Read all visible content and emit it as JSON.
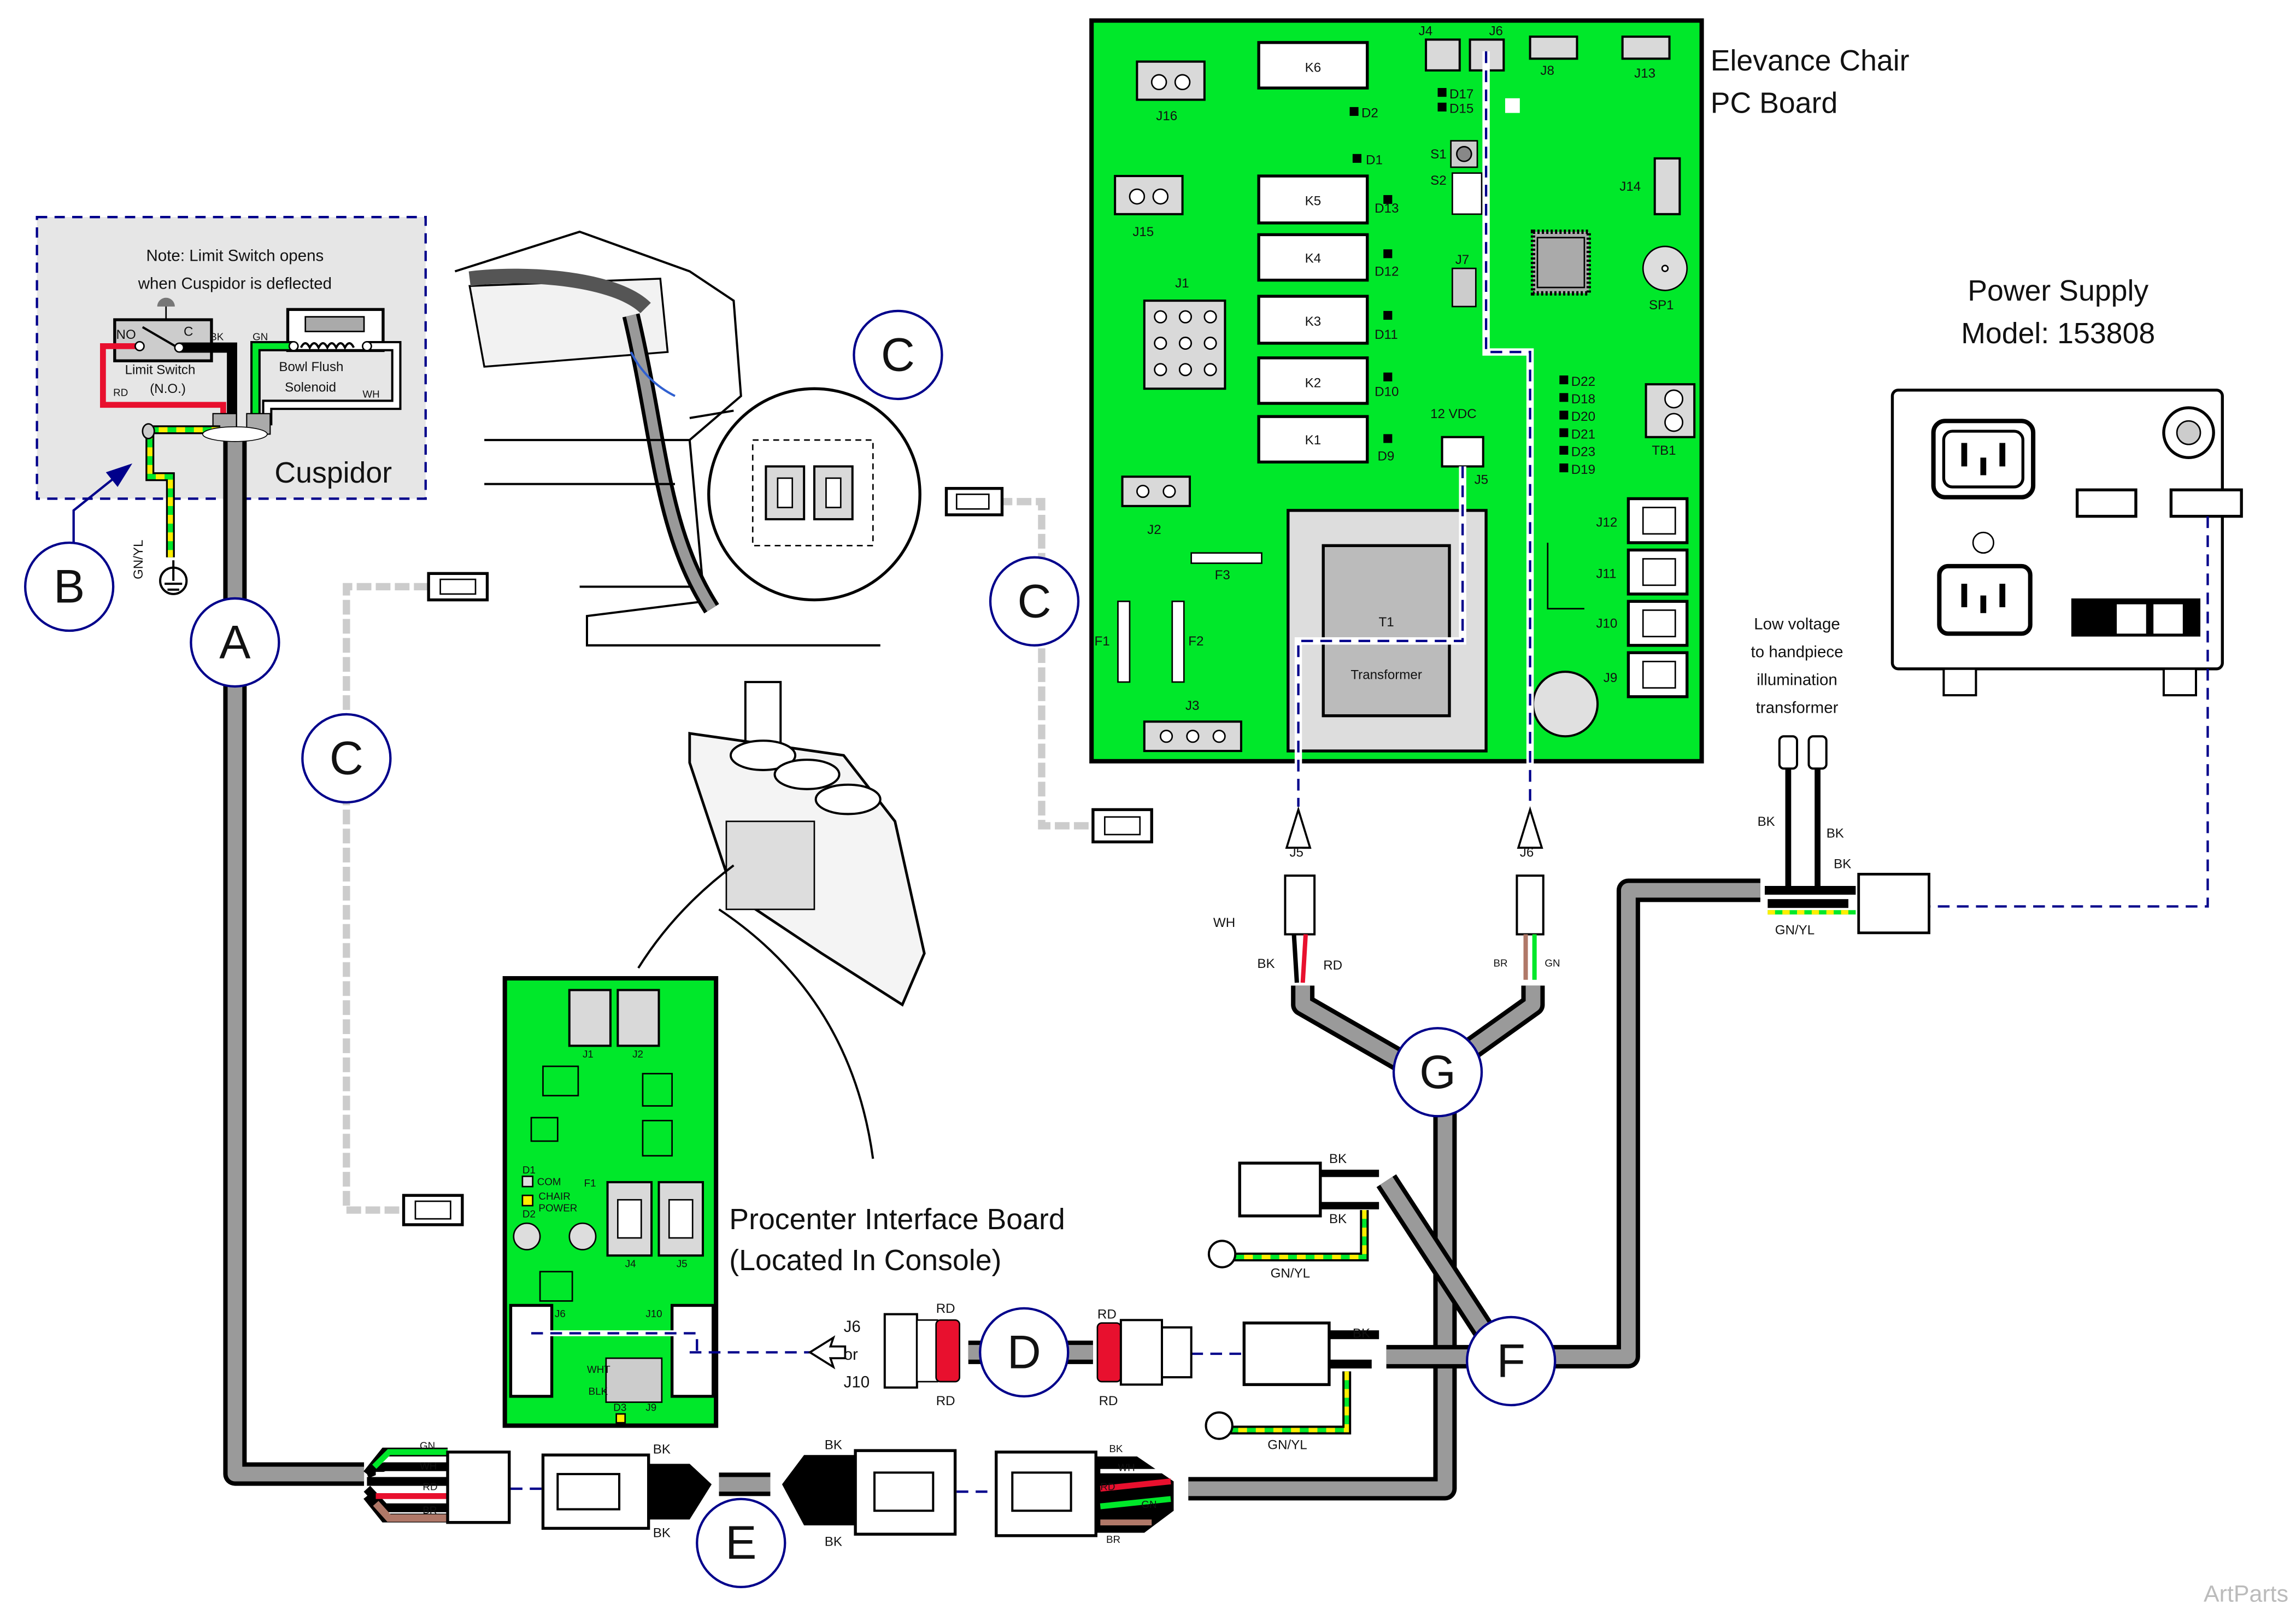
{
  "colors": {
    "pcb": "#00e82a",
    "wire_red": "#e8102e",
    "wire_green": "#00e82a",
    "wire_yellow": "#ffee00",
    "wire_brown": "#b07868",
    "cable": "#9a9a9a",
    "callout": "#00008b"
  },
  "callouts": {
    "a": "A",
    "b": "B",
    "c": "C",
    "d": "D",
    "e": "E",
    "f": "F",
    "g": "G"
  },
  "cuspidor": {
    "note_line1": "Note: Limit Switch opens",
    "note_line2": "when Cuspidor is deflected",
    "title": "Cuspidor",
    "switch_label": "Limit Switch",
    "switch_type": "(N.O.)",
    "no": "NO",
    "c": "C",
    "bk": "BK",
    "rd": "RD",
    "gn": "GN",
    "wh": "WH",
    "solenoid_line1": "Bowl Flush",
    "solenoid_line2": "Solenoid",
    "ground_wire": "GN/YL"
  },
  "pc_board": {
    "title_line1": "Elevance Chair",
    "title_line2": "PC Board",
    "relays": [
      "K6",
      "K5",
      "K4",
      "K3",
      "K2",
      "K1"
    ],
    "diodes": [
      "D2",
      "D1",
      "D13",
      "D12",
      "D11",
      "D10",
      "D9",
      "D17",
      "D15"
    ],
    "status_leds": [
      "D22",
      "D18",
      "D20",
      "D21",
      "D23",
      "D19"
    ],
    "connectors": {
      "j16": "J16",
      "j15": "J15",
      "j1": "J1",
      "j2": "J2",
      "j3": "J3",
      "j4": "J4",
      "j6": "J6",
      "j8": "J8",
      "j13": "J13",
      "j14": "J14",
      "j7": "J7",
      "j5": "J5",
      "j12": "J12",
      "j11": "J11",
      "j10": "J10",
      "j9": "J9",
      "tb1": "TB1"
    },
    "fuses": {
      "f1": "F1",
      "f2": "F2",
      "f3": "F3"
    },
    "s1": "S1",
    "s2": "S2",
    "sp1": "SP1",
    "vdc": "12 VDC",
    "t1": "T1",
    "transformer": "Transformer"
  },
  "power_supply": {
    "title_line1": "Power Supply",
    "title_line2": "Model: 153808"
  },
  "low_voltage": {
    "line1": "Low voltage",
    "line2": "to handpiece",
    "line3": "illumination",
    "line4": "transformer",
    "bk1": "BK",
    "bk2": "BK",
    "bk3": "BK",
    "gnyl": "GN/YL"
  },
  "harness_g": {
    "j5": "J5",
    "j6": "J6",
    "wh": "WH",
    "bk": "BK",
    "rd": "RD",
    "br": "BR",
    "gn": "GN"
  },
  "harness_f": {
    "bk1": "BK",
    "bk2": "BK",
    "gnyl1": "GN/YL",
    "bk3": "BK",
    "gnyl2": "GN/YL"
  },
  "procenter": {
    "title_line1": "Procenter Interface Board",
    "title_line2": "(Located In Console)",
    "j1": "J1",
    "j2": "J2",
    "j4": "J4",
    "j5": "J5",
    "j6": "J6",
    "j10": "J10",
    "j9": "J9",
    "d1": "D1",
    "d2": "D2",
    "d3": "D3",
    "f1": "F1",
    "com": "COM",
    "chair": "CHAIR",
    "power": "POWER",
    "wht": "WHT",
    "blk": "BLK"
  },
  "harness_d": {
    "j6": "J6",
    "or": "or",
    "j10": "J10",
    "rd1": "RD",
    "rd2": "RD",
    "rd3": "RD",
    "rd4": "RD"
  },
  "harness_e": {
    "gn": "GN",
    "wh": "WH",
    "rd": "RD",
    "br": "BR",
    "bk1": "BK",
    "bk2": "BK",
    "bk3": "BK",
    "bk4": "BK",
    "bk5": "BK",
    "wh2": "WH",
    "rd2": "RD",
    "gn2": "GN",
    "br2": "BR"
  },
  "watermark": "ArtParts"
}
